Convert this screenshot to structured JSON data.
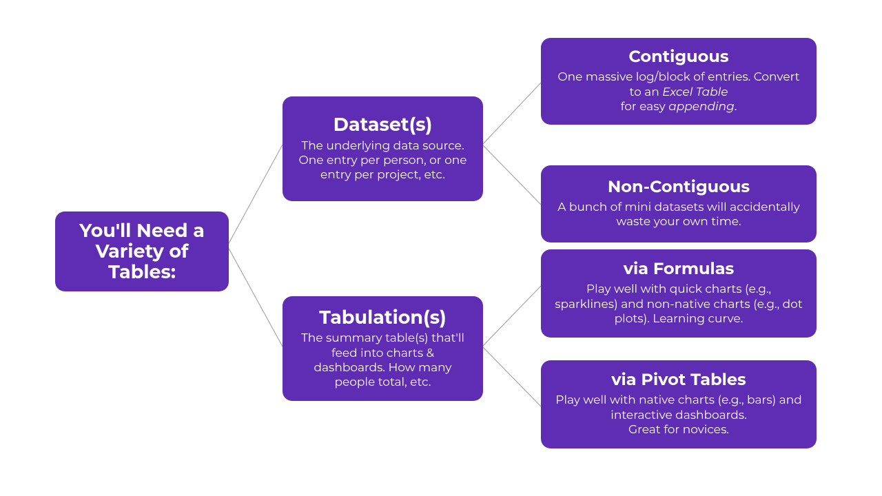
{
  "root": {
    "title": "You'll Need a Variety of Tables:"
  },
  "mid": {
    "datasets": {
      "title": "Dataset(s)",
      "desc": "The underlying data source. One entry per person, or one entry per project, etc."
    },
    "tabulations": {
      "title": "Tabulation(s)",
      "desc": "The summary table(s) that'll feed into charts & dashboards. How many people total, etc."
    }
  },
  "leaf": {
    "contiguous": {
      "title": "Contiguous",
      "desc_html": "One massive log/block of entries. Convert to an <em>Excel Table</em><br>for easy <em>appending</em>."
    },
    "noncontiguous": {
      "title": "Non-Contiguous",
      "desc_html": "A bunch of mini datasets will accidentally waste your own time."
    },
    "formulas": {
      "title": "via Formulas",
      "desc_html": "Play well with quick charts (e.g., sparklines) and non-native charts (e.g., dot plots). Learning curve."
    },
    "pivot": {
      "title": "via Pivot Tables",
      "desc_html": "Play well with native charts (e.g., bars) and interactive dashboards.<br>Great for novices."
    }
  }
}
